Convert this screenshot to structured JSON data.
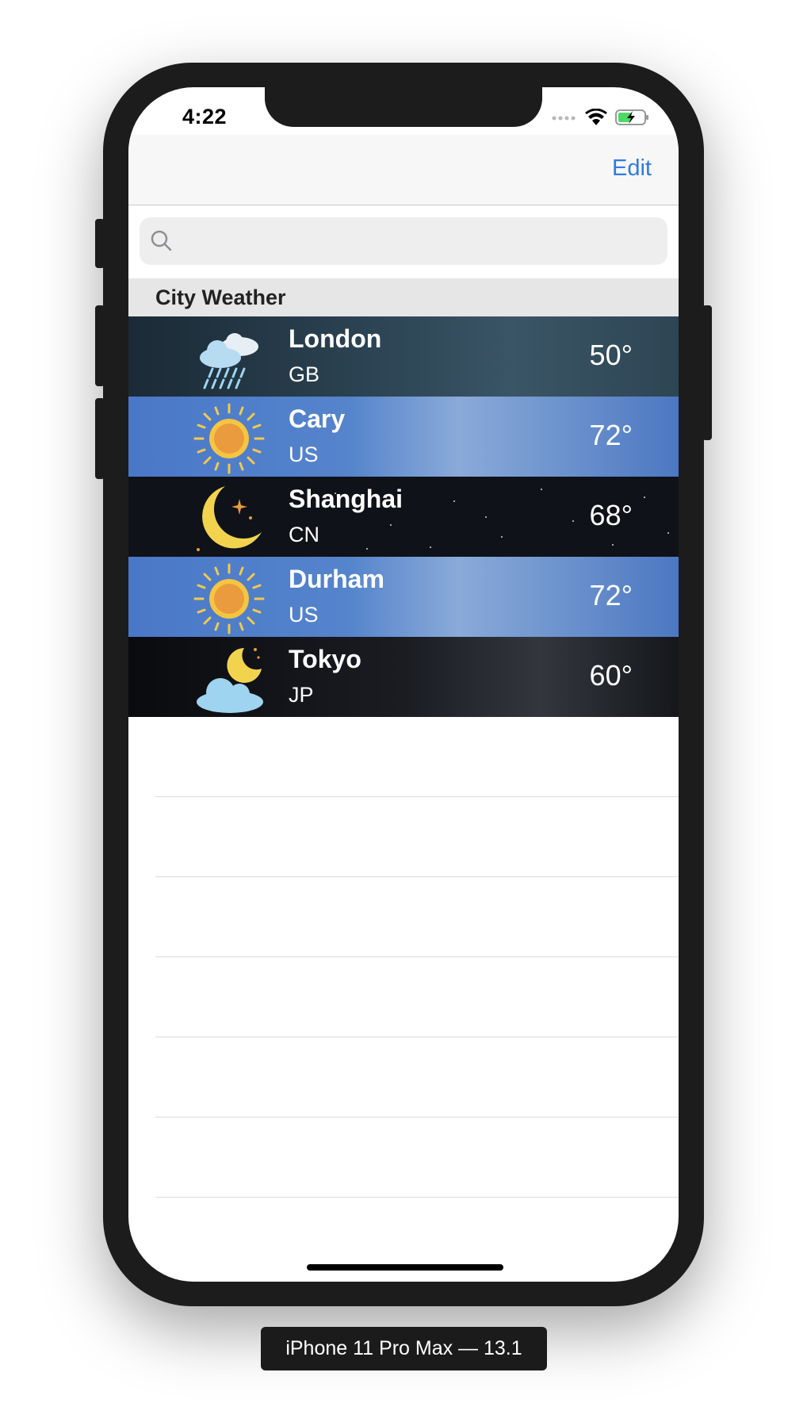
{
  "status_bar": {
    "time": "4:22"
  },
  "navbar": {
    "edit_label": "Edit"
  },
  "search": {
    "placeholder": ""
  },
  "section": {
    "title": "City Weather"
  },
  "rows": [
    {
      "city": "London",
      "country": "GB",
      "temp": "50°",
      "icon": "cloud-rain-icon"
    },
    {
      "city": "Cary",
      "country": "US",
      "temp": "72°",
      "icon": "sun-icon"
    },
    {
      "city": "Shanghai",
      "country": "CN",
      "temp": "68°",
      "icon": "moon-icon"
    },
    {
      "city": "Durham",
      "country": "US",
      "temp": "72°",
      "icon": "sun-icon"
    },
    {
      "city": "Tokyo",
      "country": "JP",
      "temp": "60°",
      "icon": "night-cloud-icon"
    }
  ],
  "device_label": "iPhone 11 Pro Max — 13.1",
  "colors": {
    "accent": "#2f7be0",
    "sunny_row": "#4a78c8",
    "night_row": "#0f1218"
  }
}
